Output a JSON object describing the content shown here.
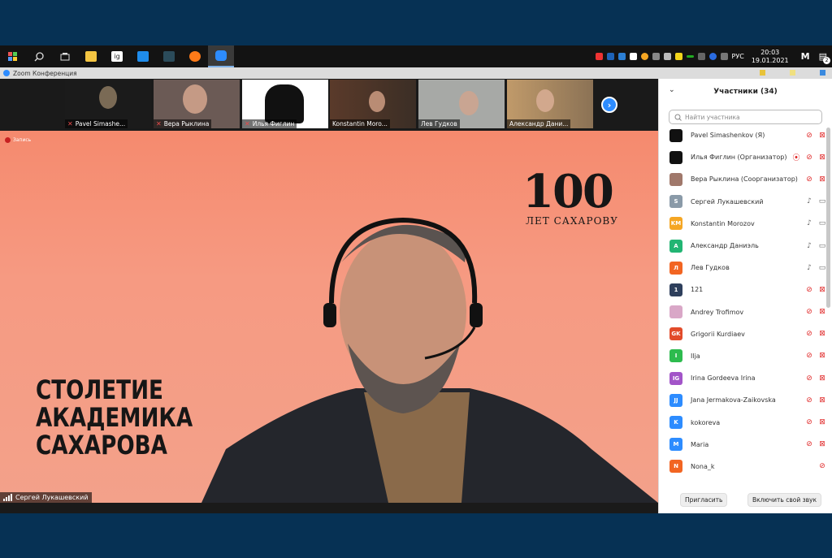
{
  "taskbar": {
    "time": "20:03",
    "date": "19.01.2021",
    "lang": "РУС",
    "notif_count": "2",
    "apps": [
      "windows-start",
      "search",
      "task-view",
      "explorer",
      "ig",
      "editor",
      "teams",
      "firefox",
      "zoom"
    ],
    "ig_label": "ig"
  },
  "window": {
    "title": "Zoom Конференция"
  },
  "thumbnails": [
    {
      "name": "Pavel Simashe...",
      "muted": true,
      "bg": "#1b1b1b"
    },
    {
      "name": "Вера Рыклина",
      "muted": true,
      "bg": "#6b5a55"
    },
    {
      "name": "Илья Фиглин",
      "muted": true,
      "bg": "#ffffff"
    },
    {
      "name": "Konstantin Moro...",
      "muted": false,
      "bg": "#4a3a30"
    },
    {
      "name": "Лев Гудков",
      "muted": false,
      "bg": "#a7a9a6"
    },
    {
      "name": "Александр Дани...",
      "muted": false,
      "bg": "#8b7255"
    }
  ],
  "main": {
    "recording": "Запись",
    "logo_number": "100",
    "logo_sub": "ЛЕТ САХАРОВУ",
    "title_lines": [
      "СТОЛЕТИЕ",
      "АКАДЕМИКА",
      "САХАРОВА"
    ],
    "speaker": "Сергей Лукашевский"
  },
  "panel": {
    "title": "Участники (34)",
    "search_placeholder": "Найти участника",
    "participants": [
      {
        "name": "Pavel Simashenkov (Я)",
        "initials": "",
        "color": "#111111",
        "mic": "muted",
        "video": "off"
      },
      {
        "name": "Илья Фиглин (Организатор)",
        "initials": "",
        "color": "#111111",
        "mic": "muted",
        "video": "off",
        "rec": true
      },
      {
        "name": "Вера Рыклина (Соорганизатор)",
        "initials": "",
        "color": "#a0786b",
        "mic": "muted",
        "video": "off"
      },
      {
        "name": "Сергей Лукашевский",
        "initials": "S",
        "color": "#8a9aa8",
        "mic": "on",
        "video": "on"
      },
      {
        "name": "Konstantin Morozov",
        "initials": "KM",
        "color": "#f5a623",
        "mic": "on",
        "video": "on"
      },
      {
        "name": "Александр Даниэль",
        "initials": "A",
        "color": "#22b573",
        "mic": "on",
        "video": "on"
      },
      {
        "name": "Лев Гудков",
        "initials": "Л",
        "color": "#f26522",
        "mic": "on",
        "video": "on"
      },
      {
        "name": "121",
        "initials": "1",
        "color": "#2e3f5c",
        "mic": "muted",
        "video": "off"
      },
      {
        "name": "Andrey Trofimov",
        "initials": "",
        "color": "#d9a7c7",
        "mic": "muted",
        "video": "off"
      },
      {
        "name": "Grigorii Kurdiaev",
        "initials": "GK",
        "color": "#e24b2a",
        "mic": "muted",
        "video": "off"
      },
      {
        "name": "Ilja",
        "initials": "I",
        "color": "#2dbb4e",
        "mic": "muted",
        "video": "off"
      },
      {
        "name": "Irina Gordeeva Irina",
        "initials": "IG",
        "color": "#a254c8",
        "mic": "muted",
        "video": "off"
      },
      {
        "name": "Jana Jermakova-Zaikovska",
        "initials": "JJ",
        "color": "#2d8cff",
        "mic": "muted",
        "video": "off"
      },
      {
        "name": "kokoreva",
        "initials": "K",
        "color": "#2d8cff",
        "mic": "muted",
        "video": "off"
      },
      {
        "name": "Maria",
        "initials": "M",
        "color": "#2d8cff",
        "mic": "muted",
        "video": "off"
      },
      {
        "name": "Nona_k",
        "initials": "N",
        "color": "#f26522",
        "mic": "muted",
        "video": ""
      }
    ],
    "invite": "Пригласить",
    "unmute": "Включить свой звук"
  }
}
